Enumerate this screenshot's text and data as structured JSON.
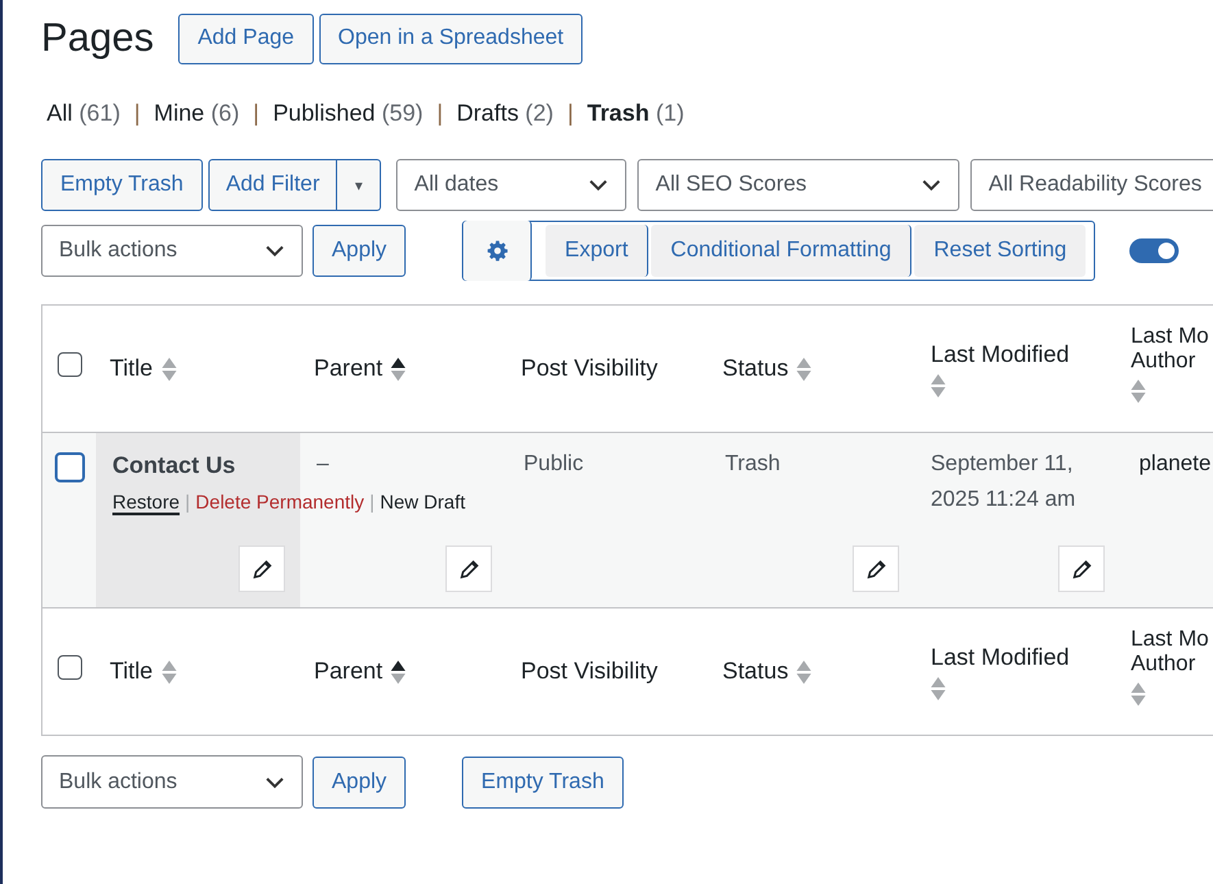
{
  "page_title": "Pages",
  "header_buttons": [
    "Add Page",
    "Open in a Spreadsheet"
  ],
  "views": [
    {
      "label": "All",
      "count": "(61)",
      "selected": false
    },
    {
      "separator": "|",
      "label": "Mine",
      "count": "(6)",
      "selected": false
    },
    {
      "separator": "|",
      "label": "Published",
      "count": "(59)",
      "selected": false
    },
    {
      "separator": "|",
      "label": "Drafts",
      "count": "(2)",
      "selected": false
    },
    {
      "separator": "|",
      "label": "Trash",
      "count": "(1)",
      "selected": true
    }
  ],
  "top_toolbar": {
    "empty_trash": "Empty Trash",
    "add_filter": "Add Filter",
    "filter_caret": "▾",
    "selects": [
      {
        "value": "All dates"
      },
      {
        "value": "All SEO Scores"
      },
      {
        "value": "All Readability Scores"
      }
    ]
  },
  "bulk_bar": {
    "bulk_select": "Bulk actions",
    "apply": "Apply",
    "tools": [
      "Export",
      "Conditional Formatting",
      "Reset Sorting"
    ],
    "toggle_on": true
  },
  "table": {
    "select_all_checked": false,
    "columns": [
      {
        "label": "Title",
        "sorted": false
      },
      {
        "label": "Parent",
        "sorted": true
      },
      {
        "label": "Post Visibility"
      },
      {
        "label": "Status",
        "sorted": false
      },
      {
        "label": "Last Modified",
        "sorted": false
      },
      {
        "label": "Last Mo Author",
        "sorted": false
      }
    ],
    "footer_select_all_checked": false,
    "footer_columns": [
      {
        "label": "Title",
        "sorted": false
      },
      {
        "label": "Parent",
        "sorted": true
      },
      {
        "label": "Post Visibility"
      },
      {
        "label": "Status",
        "sorted": false
      },
      {
        "label": "Last Modified",
        "sorted": false
      },
      {
        "label": "Last Mo Author",
        "sorted": false
      }
    ],
    "rows": [
      {
        "checked": false,
        "cells": [
          {
            "kind": "title",
            "text": "Contact Us",
            "editable": true,
            "actions": [
              {
                "label": "Restore",
                "kind": "restore"
              },
              {
                "separator": "|",
                "label": "Delete Permanently",
                "kind": "delete"
              },
              {
                "separator": "|",
                "label": "New Draft",
                "kind": "draft"
              }
            ]
          },
          {
            "text": "–",
            "editable": true
          },
          {
            "text": "Public",
            "editable": false
          },
          {
            "text": "Trash",
            "editable": true
          },
          {
            "text": "September 11, 2025 11:24 am",
            "editable": true
          },
          {
            "text": "planete",
            "editable": false
          }
        ]
      }
    ]
  },
  "bottom_bar": {
    "bulk_select": "Bulk actions",
    "apply": "Apply",
    "empty_trash": "Empty Trash"
  }
}
